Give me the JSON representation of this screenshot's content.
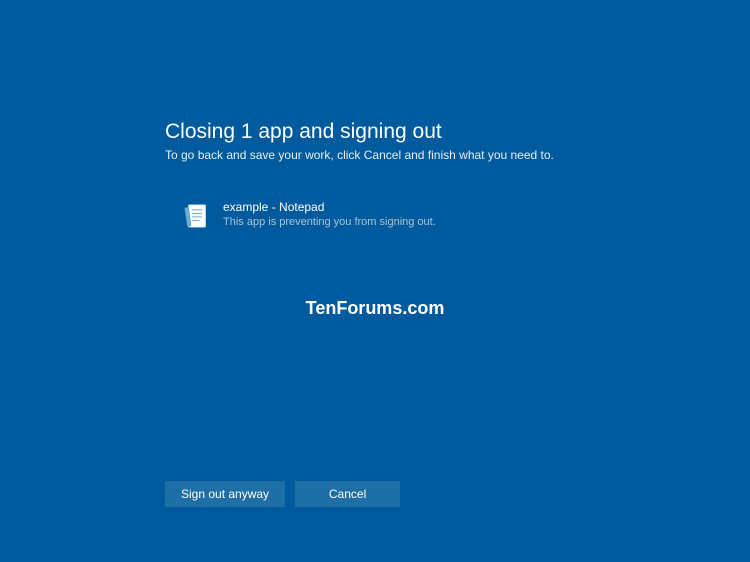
{
  "header": {
    "title": "Closing 1 app and signing out",
    "subtitle": "To go back and save your work, click Cancel and finish what you need to."
  },
  "apps": [
    {
      "name": "example - Notepad",
      "status": "This app is preventing you from signing out."
    }
  ],
  "watermark": "TenForums.com",
  "buttons": {
    "confirm": "Sign out anyway",
    "cancel": "Cancel"
  }
}
